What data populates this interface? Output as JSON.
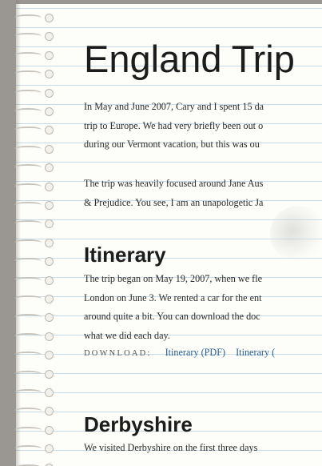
{
  "page": {
    "title": "England Trip",
    "intro": [
      "In May and June 2007, Cary and I spent 15 da",
      "trip to Europe. We had very briefly been out o",
      "during our Vermont vacation, but this was ou"
    ],
    "focus": [
      "The trip was heavily focused around Jane Aus",
      "& Prejudice. You see, I am an unapologetic Ja"
    ]
  },
  "itinerary": {
    "heading": "Itinerary",
    "lines": [
      "The trip began on May 19, 2007, when we fle",
      "London on June 3. We rented a car for the ent",
      "around quite a bit. You can download the doc",
      "what we did each day."
    ],
    "download_label": "DOWNLOAD:",
    "links": [
      "Itinerary (PDF)",
      "Itinerary ("
    ]
  },
  "derbyshire": {
    "heading": "Derbyshire",
    "lines": [
      "We visited Derbyshire on the first three days"
    ]
  }
}
